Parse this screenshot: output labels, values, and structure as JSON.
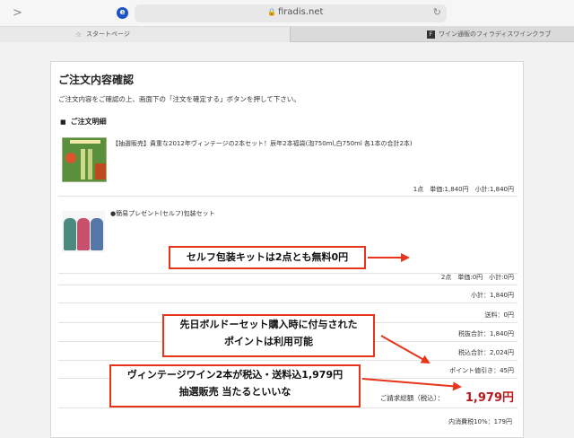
{
  "browser": {
    "url": "firadis.net",
    "tabs": [
      {
        "label": "スタートページ"
      },
      {
        "label": "ワイン通販のフィラディスワインクラブ"
      }
    ]
  },
  "page": {
    "title": "ご注文内容確認",
    "instruction": "ご注文内容をご確認の上、画面下の「注文を確定する」ボタンを押して下さい。",
    "section_heading": "ご注文明細"
  },
  "items": [
    {
      "name": "【抽選販売】貴重な2012年ヴィンテージの2本セット！辰年2本福袋(泡750ml,白750ml 各1本の合計2本)",
      "detail": "1点　単価:1,840円　小計:1,840円"
    },
    {
      "name": "●簡易プレゼント(セルフ)包装セット",
      "detail": "2点　単価:0円　小計:0円"
    }
  ],
  "summary": {
    "subtotal": "小計：1,840円",
    "shipping": "送料：0円",
    "tax_excluded_total": "税抜合計：1,840円",
    "tax_included_total": "税込合計：2,024円",
    "point_discount": "ポイント値引き：45円",
    "billing_label": "ご請求総額（税込）：",
    "billing_amount": "1,979円",
    "tax_note": "内消費税10%：179円"
  },
  "callouts": {
    "wrap_free": "セルフ包装キットは2点とも無料0円",
    "points_line1": "先日ボルドーセット購入時に付与された",
    "points_line2": "ポイントは利用可能",
    "vintage_line1": "ヴィンテージワイン2本が税込・送料込1,979円",
    "vintage_line2": "抽選販売 当たるといいな"
  },
  "colors": {
    "accent_red": "#e6351a",
    "total_red": "#b6181b",
    "site_icon_blue": "#1b54c4"
  }
}
